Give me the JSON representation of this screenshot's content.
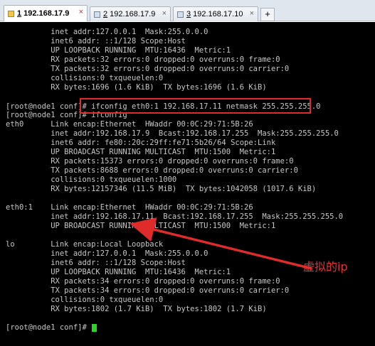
{
  "tabs": [
    {
      "num": "1",
      "label": "192.168.17.9",
      "close": "×"
    },
    {
      "num": "2",
      "label": "192.168.17.9",
      "close": "×"
    },
    {
      "num": "3",
      "label": "192.168.17.10",
      "close": "×"
    }
  ],
  "new_tab": "+",
  "terminal": {
    "lines": [
      "          inet addr:127.0.0.1  Mask:255.0.0.0",
      "          inet6 addr: ::1/128 Scope:Host",
      "          UP LOOPBACK RUNNING  MTU:16436  Metric:1",
      "          RX packets:32 errors:0 dropped:0 overruns:0 frame:0",
      "          TX packets:32 errors:0 dropped:0 overruns:0 carrier:0",
      "          collisions:0 txqueuelen:0",
      "          RX bytes:1696 (1.6 KiB)  TX bytes:1696 (1.6 KiB)",
      "",
      "[root@node1 conf]# ifconfig eth0:1 192.168.17.11 netmask 255.255.255.0",
      "[root@node1 conf]# ifconfig",
      "eth0      Link encap:Ethernet  HWaddr 00:0C:29:71:5B:26",
      "          inet addr:192.168.17.9  Bcast:192.168.17.255  Mask:255.255.255.0",
      "          inet6 addr: fe80::20c:29ff:fe71:5b26/64 Scope:Link",
      "          UP BROADCAST RUNNING MULTICAST  MTU:1500  Metric:1",
      "          RX packets:15373 errors:0 dropped:0 overruns:0 frame:0",
      "          TX packets:8688 errors:0 dropped:0 overruns:0 carrier:0",
      "          collisions:0 txqueuelen:1000",
      "          RX bytes:12157346 (11.5 MiB)  TX bytes:1042058 (1017.6 KiB)",
      "",
      "eth0:1    Link encap:Ethernet  HWaddr 00:0C:29:71:5B:26",
      "          inet addr:192.168.17.11  Bcast:192.168.17.255  Mask:255.255.255.0",
      "          UP BROADCAST RUNNING MULTICAST  MTU:1500  Metric:1",
      "",
      "lo        Link encap:Local Loopback",
      "          inet addr:127.0.0.1  Mask:255.0.0.0",
      "          inet6 addr: ::1/128 Scope:Host",
      "          UP LOOPBACK RUNNING  MTU:16436  Metric:1",
      "          RX packets:34 errors:0 dropped:0 overruns:0 frame:0",
      "          TX packets:34 errors:0 dropped:0 overruns:0 carrier:0",
      "          collisions:0 txqueuelen:0",
      "          RX bytes:1802 (1.7 KiB)  TX bytes:1802 (1.7 KiB)",
      "",
      "[root@node1 conf]# "
    ]
  },
  "annotation": {
    "text": "虚拟的ip",
    "color": "#e53333"
  },
  "colors": {
    "terminal_bg": "#000000",
    "terminal_fg": "#c8c8c8",
    "cursor": "#27d827",
    "highlight_box": "#e02b2b"
  },
  "icons": {
    "tab": "terminal-session-icon",
    "close": "close-icon",
    "add": "plus-icon"
  }
}
